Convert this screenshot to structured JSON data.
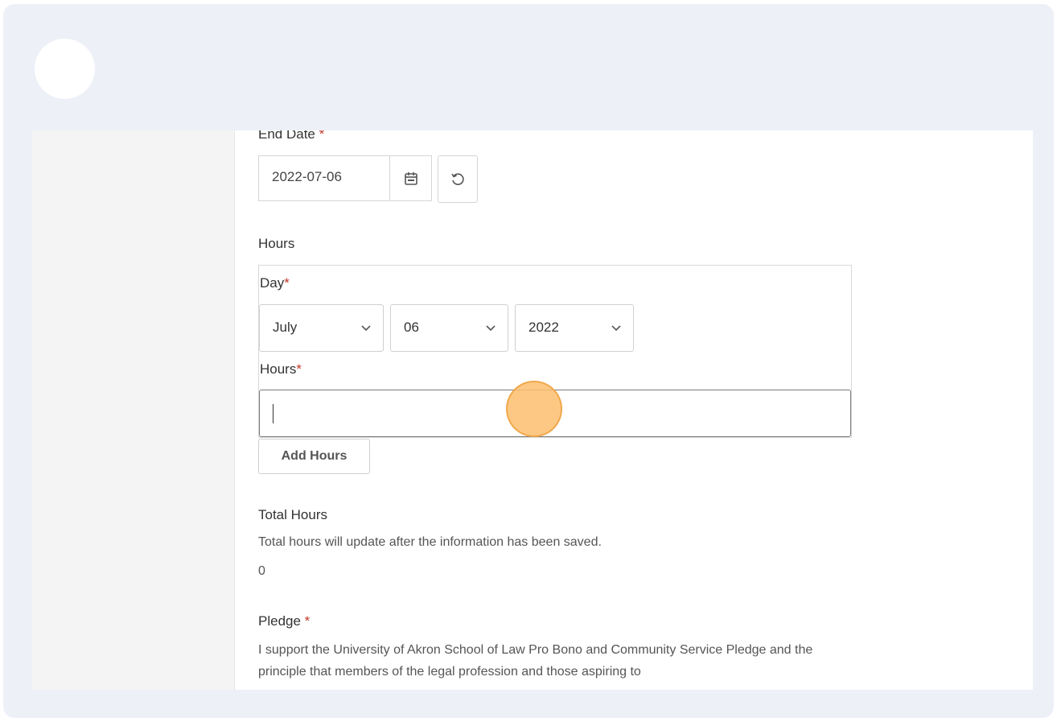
{
  "end_date": {
    "label": "End Date",
    "required_mark": "*",
    "value": "2022-07-06"
  },
  "hours_section": {
    "title": "Hours",
    "day_label": "Day",
    "day_required": "*",
    "month_value": "July",
    "day_value": "06",
    "year_value": "2022",
    "hours_label": "Hours",
    "hours_required": "*",
    "hours_value": "",
    "add_button": "Add Hours"
  },
  "total_hours": {
    "title": "Total Hours",
    "note": "Total hours will update after the information has been saved.",
    "value": "0"
  },
  "pledge": {
    "title": "Pledge",
    "required_mark": "*",
    "text": "I support the University of Akron School of Law Pro Bono and Community Service Pledge and the principle that members of the legal profession and those aspiring to"
  },
  "icons": {
    "calendar": "calendar-icon",
    "reset": "reset-icon",
    "chevron": "chevron-down-icon"
  },
  "colors": {
    "frame_bg": "#eef0f8",
    "required": "#c0392b",
    "click_highlight": "#fdbe6e"
  }
}
